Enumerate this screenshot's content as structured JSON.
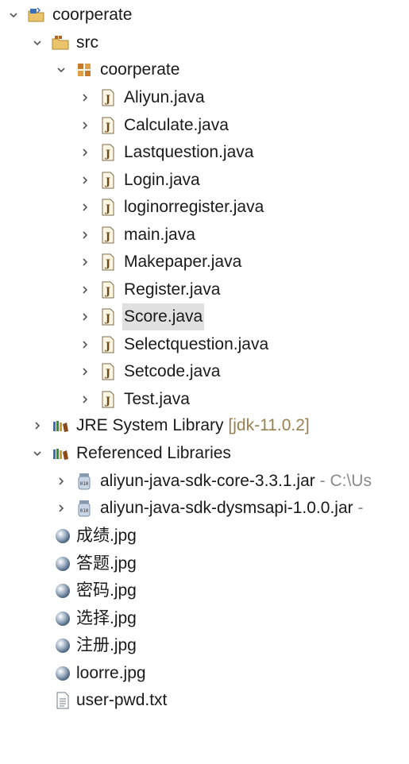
{
  "project": {
    "name": "coorperate",
    "src": {
      "label": "src",
      "package": {
        "name": "coorperate",
        "files": [
          {
            "name": "Aliyun.java"
          },
          {
            "name": "Calculate.java"
          },
          {
            "name": "Lastquestion.java"
          },
          {
            "name": "Login.java"
          },
          {
            "name": "loginorregister.java"
          },
          {
            "name": "main.java"
          },
          {
            "name": "Makepaper.java"
          },
          {
            "name": "Register.java"
          },
          {
            "name": "Score.java",
            "selected": true
          },
          {
            "name": "Selectquestion.java"
          },
          {
            "name": "Setcode.java"
          },
          {
            "name": "Test.java"
          }
        ]
      }
    },
    "jre": {
      "label": "JRE System Library",
      "suffix": "[jdk-11.0.2]"
    },
    "referenced": {
      "label": "Referenced Libraries",
      "jars": [
        {
          "name": "aliyun-java-sdk-core-3.3.1.jar",
          "suffix": " - C:\\Us"
        },
        {
          "name": "aliyun-java-sdk-dysmsapi-1.0.0.jar",
          "suffix": " -"
        }
      ]
    },
    "resources": [
      {
        "name": "成绩.jpg",
        "icon": "image-file-icon"
      },
      {
        "name": "答题.jpg",
        "icon": "image-file-icon"
      },
      {
        "name": "密码.jpg",
        "icon": "image-file-icon"
      },
      {
        "name": "选择.jpg",
        "icon": "image-file-icon"
      },
      {
        "name": "注册.jpg",
        "icon": "image-file-icon"
      },
      {
        "name": "loorre.jpg",
        "icon": "image-file-icon"
      },
      {
        "name": "user-pwd.txt",
        "icon": "text-file-icon"
      }
    ]
  },
  "colors": {
    "selection": "#e0e0e0",
    "decoration": "#9a8050",
    "decoration_gray": "#8a8a8a"
  }
}
